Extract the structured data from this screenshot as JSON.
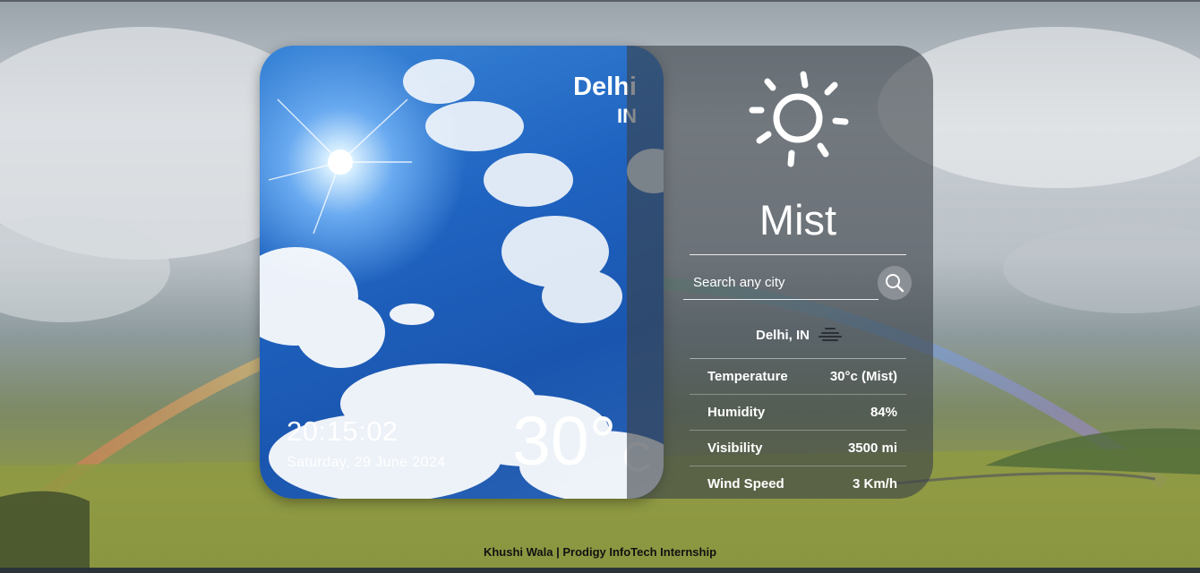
{
  "location": {
    "city": "Delhi",
    "country": "IN"
  },
  "clock": {
    "time": "20:15:02",
    "date": "Saturday, 29 June 2024"
  },
  "current": {
    "temperature": "30°",
    "unit": "C",
    "condition": "Mist"
  },
  "search": {
    "placeholder": "Search any city"
  },
  "details": {
    "location_label": "Delhi, IN",
    "rows": [
      {
        "label": "Temperature",
        "value": "30°c (Mist)"
      },
      {
        "label": "Humidity",
        "value": "84%"
      },
      {
        "label": "Visibility",
        "value": "3500 mi"
      },
      {
        "label": "Wind Speed",
        "value": "3 Km/h"
      }
    ]
  },
  "footer": {
    "credit": "Khushi Wala | Prodigy InfoTech Internship"
  },
  "icons": {
    "weather": "sun-icon",
    "search": "search-icon",
    "condition": "mist-icon"
  },
  "colors": {
    "accent": "#1f63c0",
    "panel": "#3c4248"
  }
}
